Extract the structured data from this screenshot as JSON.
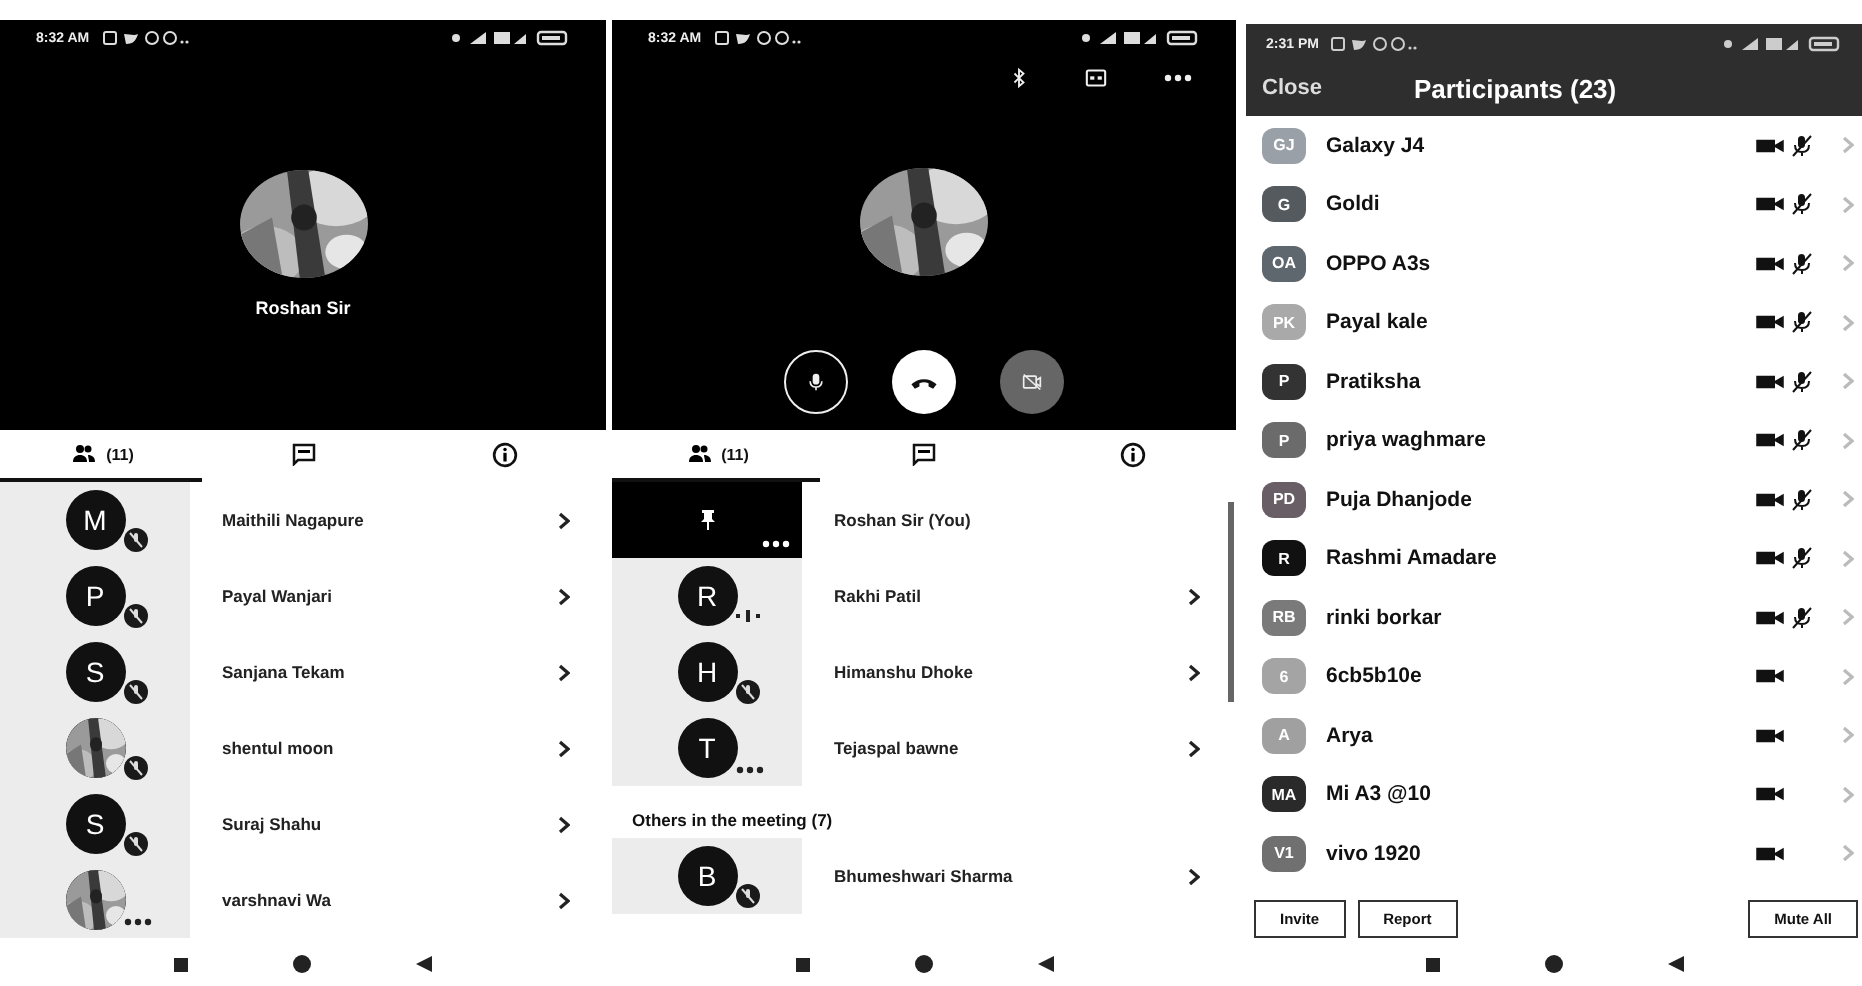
{
  "screens": [
    {
      "kind": "call",
      "status_bar": {
        "time": "8:32 AM"
      },
      "call": {
        "name": "Roshan Sir"
      },
      "top_actions": false,
      "controls": false,
      "tabs": [
        {
          "kind": "people",
          "label": "(11)",
          "selected": true
        },
        {
          "kind": "chat",
          "selected": false
        },
        {
          "kind": "info",
          "selected": false
        }
      ],
      "participants": [
        {
          "kind": "row",
          "avatar": {
            "kind": "letter",
            "initial": "M"
          },
          "name": "Maithili Nagapure",
          "badge": {
            "kind": "muted"
          },
          "chevron": true
        },
        {
          "kind": "row",
          "avatar": {
            "kind": "letter",
            "initial": "P"
          },
          "name": "Payal Wanjari",
          "badge": {
            "kind": "muted"
          },
          "chevron": true
        },
        {
          "kind": "row",
          "avatar": {
            "kind": "letter",
            "initial": "S"
          },
          "name": "Sanjana Tekam",
          "badge": {
            "kind": "muted"
          },
          "chevron": true
        },
        {
          "kind": "row",
          "name": "shentul moon",
          "badge": {
            "kind": "muted"
          },
          "chevron": true
        },
        {
          "kind": "row",
          "avatar": {
            "kind": "letter",
            "initial": "S"
          },
          "name": "Suraj Shahu",
          "badge": {
            "kind": "muted"
          },
          "chevron": true
        },
        {
          "kind": "row",
          "name": "varshnavi Wa",
          "badge": {
            "kind": "more"
          },
          "chevron": true
        }
      ]
    },
    {
      "kind": "call",
      "status_bar": {
        "time": "8:32 AM"
      },
      "top_actions": true,
      "controls": true,
      "tabs": [
        {
          "kind": "people",
          "label": "(11)",
          "selected": true
        },
        {
          "kind": "chat",
          "selected": false
        },
        {
          "kind": "info",
          "selected": false
        }
      ],
      "participants": [
        {
          "kind": "row",
          "avatar": {
            "kind": "pinned"
          },
          "name": "Roshan Sir (You)",
          "badge": {
            "kind": "more"
          },
          "chevron": false
        },
        {
          "kind": "row",
          "avatar": {
            "kind": "letter",
            "initial": "R"
          },
          "name": "Rakhi Patil",
          "badge": {
            "kind": "speaking"
          },
          "chevron": true
        },
        {
          "kind": "row",
          "avatar": {
            "kind": "letter",
            "initial": "H"
          },
          "name": "Himanshu Dhoke",
          "badge": {
            "kind": "muted"
          },
          "chevron": true
        },
        {
          "kind": "row",
          "avatar": {
            "kind": "letter",
            "initial": "T"
          },
          "name": "Tejaspal bawne",
          "badge": {
            "kind": "more"
          },
          "chevron": true
        },
        {
          "kind": "section",
          "name": "Others in the meeting (7)"
        },
        {
          "kind": "row",
          "avatar": {
            "kind": "letter",
            "initial": "B"
          },
          "name": "Bhumeshwari Sharma",
          "badge": {
            "kind": "muted"
          },
          "chevron": true
        }
      ]
    },
    {
      "kind": "list",
      "status_bar": {
        "time": "2:31 PM"
      },
      "close": "Close",
      "title": "Participants (23)",
      "participants": [
        {
          "initials": "GJ",
          "name": "Galaxy J4",
          "color": "#9aa0a8",
          "mic_muted": true
        },
        {
          "initials": "G",
          "name": "Goldi",
          "color": "#555a5e",
          "mic_muted": true
        },
        {
          "initials": "OA",
          "name": "OPPO A3s",
          "color": "#5e666e",
          "mic_muted": true
        },
        {
          "initials": "PK",
          "name": "Payal kale",
          "color": "#a9a9a9",
          "mic_muted": true
        },
        {
          "initials": "P",
          "name": "Pratiksha",
          "color": "#333333",
          "mic_muted": true
        },
        {
          "initials": "P",
          "name": "priya  waghmare",
          "color": "#6b6b6b",
          "mic_muted": true
        },
        {
          "initials": "PD",
          "name": "Puja Dhanjode",
          "color": "#6a5e66",
          "mic_muted": true
        },
        {
          "initials": "R",
          "name": "Rashmi Amadare",
          "color": "#111111",
          "mic_muted": true
        },
        {
          "initials": "RB",
          "name": "rinki borkar",
          "color": "#7a7a7a",
          "mic_muted": true
        },
        {
          "initials": "6",
          "name": "6cb5b10e",
          "color": "#a4a4a4",
          "mic_muted": false
        },
        {
          "initials": "A",
          "name": "Arya",
          "color": "#a0a0a0",
          "mic_muted": false
        },
        {
          "initials": "MA",
          "name": "Mi A3 @10",
          "color": "#2a2a2a",
          "mic_muted": false
        },
        {
          "initials": "V1",
          "name": "vivo 1920",
          "color": "#707070",
          "mic_muted": false
        }
      ],
      "buttons": [
        "Invite",
        "Report",
        "Mute All"
      ]
    }
  ]
}
